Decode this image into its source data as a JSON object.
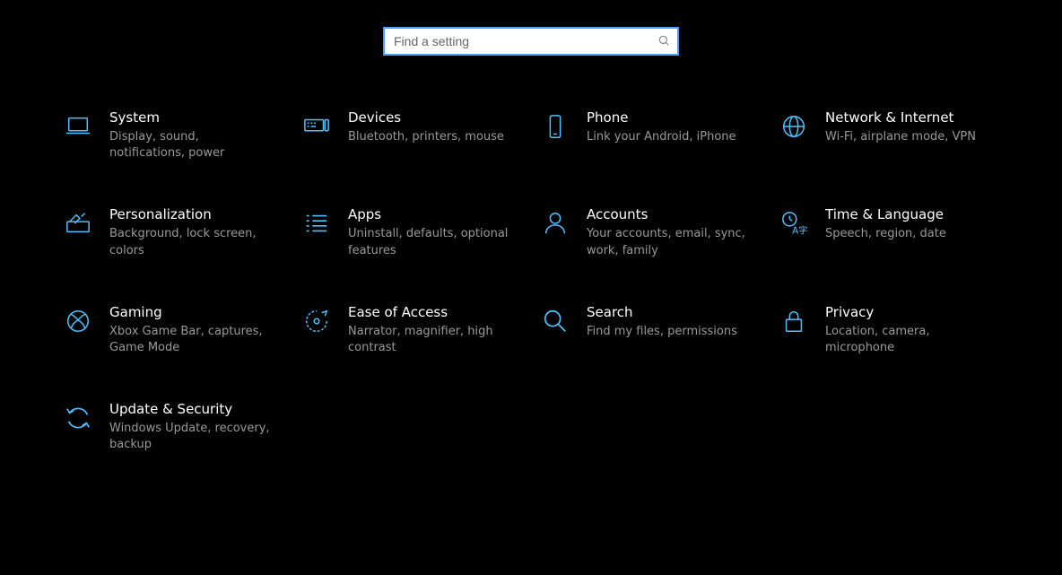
{
  "search": {
    "placeholder": "Find a setting"
  },
  "tiles": [
    {
      "title": "System",
      "sub": "Display, sound, notifications, power"
    },
    {
      "title": "Devices",
      "sub": "Bluetooth, printers, mouse"
    },
    {
      "title": "Phone",
      "sub": "Link your Android, iPhone"
    },
    {
      "title": "Network & Internet",
      "sub": "Wi-Fi, airplane mode, VPN"
    },
    {
      "title": "Personalization",
      "sub": "Background, lock screen, colors"
    },
    {
      "title": "Apps",
      "sub": "Uninstall, defaults, optional features"
    },
    {
      "title": "Accounts",
      "sub": "Your accounts, email, sync, work, family"
    },
    {
      "title": "Time & Language",
      "sub": "Speech, region, date"
    },
    {
      "title": "Gaming",
      "sub": "Xbox Game Bar, captures, Game Mode"
    },
    {
      "title": "Ease of Access",
      "sub": "Narrator, magnifier, high contrast"
    },
    {
      "title": "Search",
      "sub": "Find my files, permissions"
    },
    {
      "title": "Privacy",
      "sub": "Location, camera, microphone"
    },
    {
      "title": "Update & Security",
      "sub": "Windows Update, recovery, backup"
    }
  ]
}
